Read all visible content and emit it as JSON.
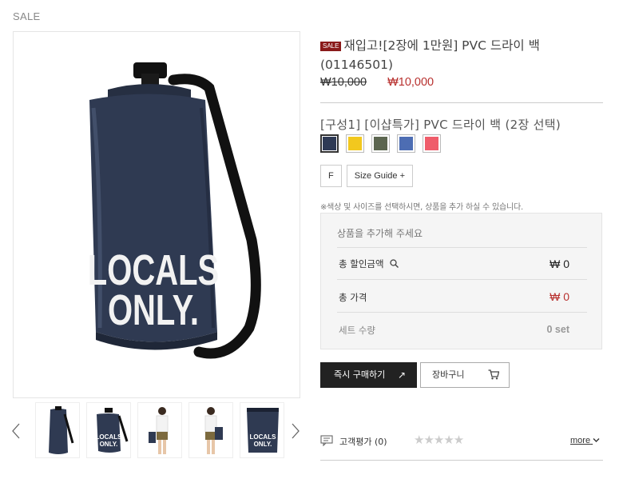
{
  "page": {
    "sale_label": "SALE"
  },
  "gallery": {
    "main_image_text_line1": "LOCALS",
    "main_image_text_line2": "ONLY.",
    "thumb_text_line1": "LOCALS",
    "thumb_text_line2": "ONLY."
  },
  "product": {
    "badge": "SALE",
    "title": "재입고![2장에 1만원] PVC 드라이 백 (01146501)",
    "original_price": "₩10,000",
    "sale_price": "₩10,000"
  },
  "options": {
    "group_title": "[구성1] [이샵특가] PVC 드라이 백 (2장 선택)",
    "colors": [
      {
        "name": "navy",
        "hex": "#2e3a55",
        "selected": true
      },
      {
        "name": "yellow",
        "hex": "#f2c81e",
        "selected": false
      },
      {
        "name": "olive",
        "hex": "#5c6650",
        "selected": false
      },
      {
        "name": "blue",
        "hex": "#4d6db3",
        "selected": false
      },
      {
        "name": "pink",
        "hex": "#ef5c6a",
        "selected": false
      }
    ],
    "size": "F",
    "size_guide": "Size Guide +"
  },
  "notice": "※색상 및 사이즈를 선택하시면, 상품을 추가 하실 수 있습니다.",
  "summary": {
    "placeholder": "상품을 추가해 주세요",
    "discount_label": "총 할인금액",
    "discount_value": "₩ 0",
    "total_label": "총 가격",
    "total_value": "₩ 0",
    "quantity_label": "세트 수량",
    "quantity_value": "0 set"
  },
  "actions": {
    "buy_now": "즉시 구매하기",
    "buy_arrow": "↗",
    "cart": "장바구니"
  },
  "reviews": {
    "label": "고객평가 (0)",
    "stars": "★★★★★",
    "more": "more"
  },
  "colors": {
    "accent_red": "#b8312f",
    "bag_navy": "#2f3a52",
    "dark_button": "#222222"
  }
}
